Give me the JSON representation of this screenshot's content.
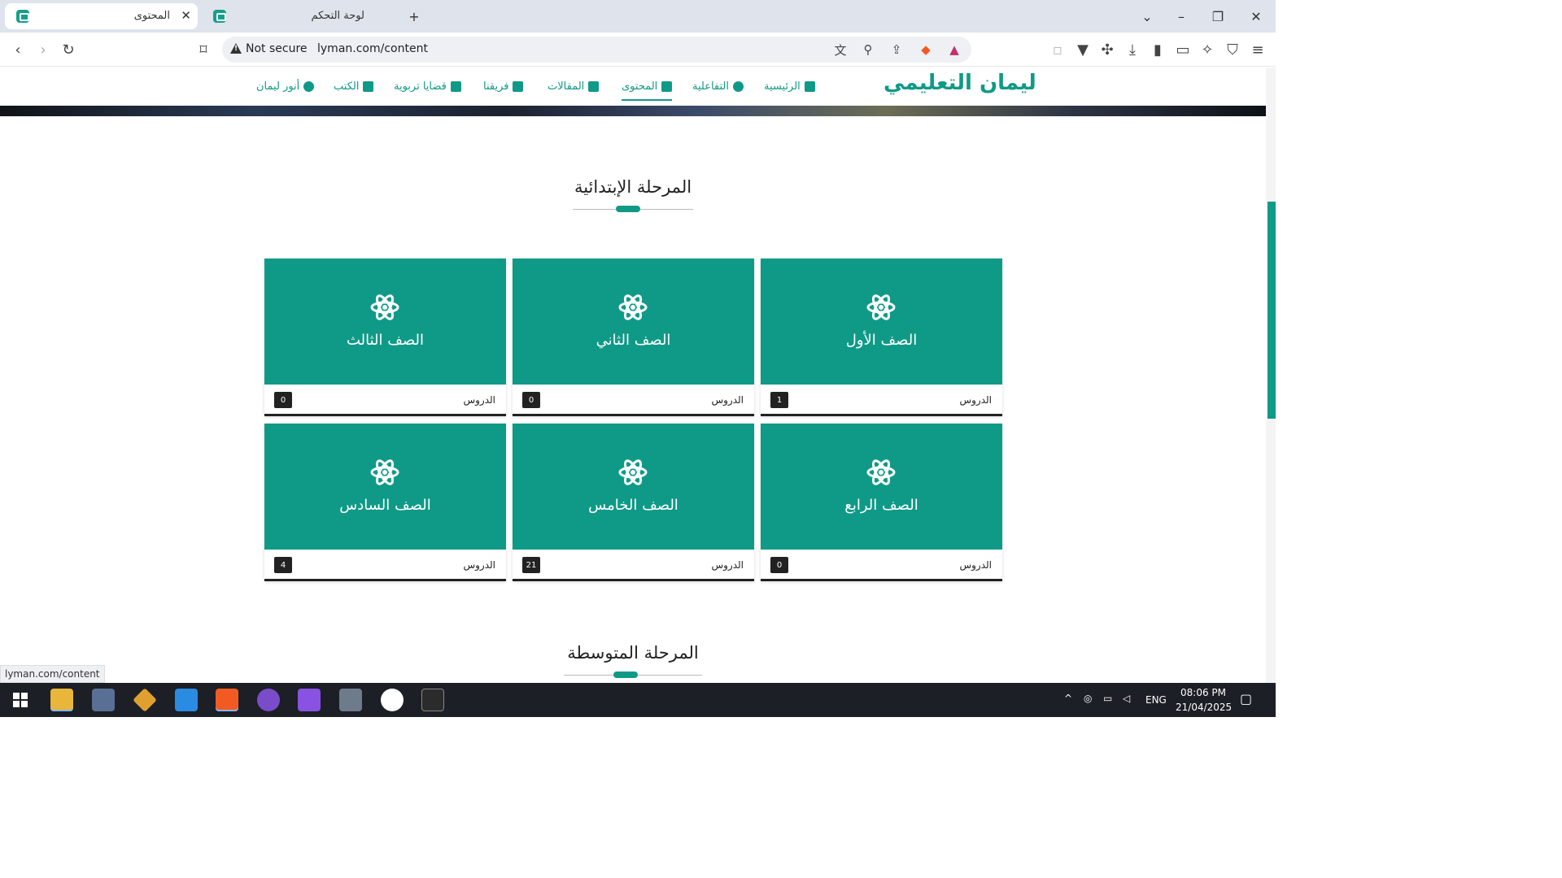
{
  "browser": {
    "tabs": [
      {
        "title": "المحتوى",
        "active": true
      },
      {
        "title": "لوحة التحكم",
        "active": false
      }
    ],
    "new_tab": "+",
    "not_secure": "Not secure",
    "url": "lyman.com/content",
    "status_url": "lyman.com/content"
  },
  "site": {
    "logo": "ليمان التعليمي",
    "nav": [
      {
        "label": "الرئيسية",
        "icon": "home-icon"
      },
      {
        "label": "التفاعلية",
        "icon": "gear-icon"
      },
      {
        "label": "المحتوى",
        "icon": "list-icon",
        "active": true
      },
      {
        "label": "المقالات",
        "icon": "newspaper-icon"
      },
      {
        "label": "فريقنا",
        "icon": "team-icon"
      },
      {
        "label": "قضايا تربوية",
        "icon": "leaf-icon"
      },
      {
        "label": "الكتب",
        "icon": "book-icon"
      },
      {
        "label": "أنور ليمان",
        "icon": "user-circle-icon"
      }
    ],
    "accent": "#0f9a87"
  },
  "primary": {
    "title": "المرحلة الإبتدائية",
    "lessons_label": "الدروس",
    "cards": [
      {
        "name": "الصف الأول",
        "count": "1"
      },
      {
        "name": "الصف الثاني",
        "count": "0"
      },
      {
        "name": "الصف الثالث",
        "count": "0"
      },
      {
        "name": "الصف الرابع",
        "count": "0"
      },
      {
        "name": "الصف الخامس",
        "count": "21"
      },
      {
        "name": "الصف السادس",
        "count": "4"
      }
    ]
  },
  "middle": {
    "title": "المرحلة المتوسطة"
  },
  "taskbar": {
    "lang": "ENG",
    "time": "08:06 PM",
    "date": "21/04/2025"
  }
}
